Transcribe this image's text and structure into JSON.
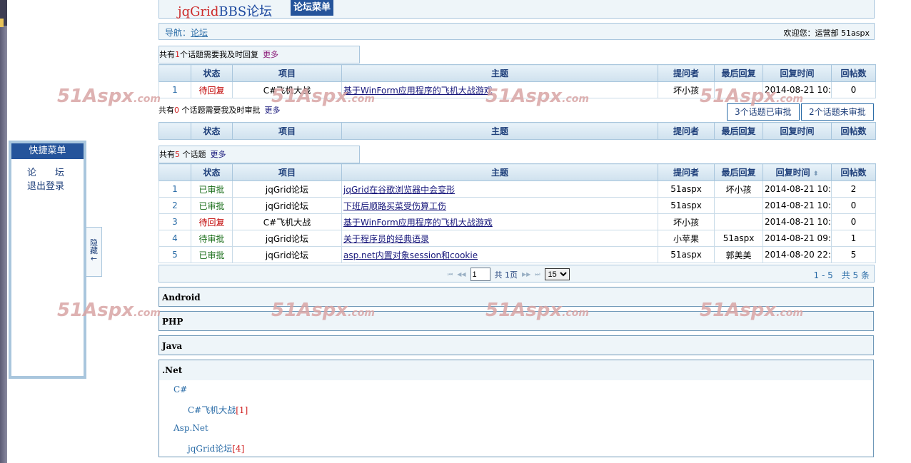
{
  "header": {
    "logo_part1": "jqGrid",
    "logo_part2": "BBS论坛",
    "menu_label": "论坛菜单"
  },
  "nav": {
    "label": "导航：",
    "link": "论坛",
    "welcome": "欢迎您：运营部 51aspx"
  },
  "quick_menu": {
    "title": "快捷菜单",
    "items": [
      "论　　坛",
      "退出登录"
    ],
    "hide_tab": "隐藏←"
  },
  "pending_reply": {
    "prefix": "共有",
    "count": "1",
    "suffix": "个话题需要我及时回复",
    "more": "更多"
  },
  "pending_review": {
    "prefix": "共有",
    "count": "0",
    "suffix": " 个话题需要我及时审批",
    "more": "更多",
    "approved_btn": "3个话题已审批",
    "unapproved_btn": "2个话题未审批"
  },
  "all_topics": {
    "prefix": "共有",
    "count": "5",
    "suffix": " 个话题",
    "more": "更多"
  },
  "columns": [
    "",
    "状态",
    "项目",
    "主题",
    "提问者",
    "最后回复",
    "回复时间",
    "回帖数"
  ],
  "sort_indicator": "⬍",
  "reply_rows": [
    [
      "1",
      "待回复",
      "C#飞机大战",
      "基于WinForm应用程序的飞机大战游戏",
      "坏小孩",
      "",
      "2014-08-21 10:",
      "0"
    ]
  ],
  "topic_rows": [
    [
      "1",
      "已审批",
      "jqGrid论坛",
      "jqGrid在谷歌浏览器中会变形",
      "51aspx",
      "坏小孩",
      "2014-08-21 10:",
      "2"
    ],
    [
      "2",
      "已审批",
      "jqGrid论坛",
      "下班后顺路买菜受伤算工伤",
      "51aspx",
      "",
      "2014-08-21 10:",
      "0"
    ],
    [
      "3",
      "待回复",
      "C#飞机大战",
      "基于WinForm应用程序的飞机大战游戏",
      "坏小孩",
      "",
      "2014-08-21 10:",
      "0"
    ],
    [
      "4",
      "待审批",
      "jqGrid论坛",
      "关于程序员的经典语录",
      "小苹果",
      "51aspx",
      "2014-08-21 09:",
      "1"
    ],
    [
      "5",
      "已审批",
      "jqGrid论坛",
      "asp.net内置对象session和cookie",
      "51aspx",
      "郭美美",
      "2014-08-20 22:",
      "5"
    ]
  ],
  "pager": {
    "first": "⏮",
    "prev": "◀◀",
    "page": "1",
    "total_pages": "共 1页",
    "next": "▶▶",
    "last": "⏭",
    "page_size": "15",
    "range": "1 - 5　共 5 条"
  },
  "categories": [
    "Android",
    "PHP",
    "Java"
  ],
  "tree": {
    "title": ".Net",
    "nodes": [
      {
        "label": "C#"
      },
      {
        "label": "C#飞机大战",
        "count": "[1]"
      },
      {
        "label": "Asp.Net"
      },
      {
        "label": "jqGrid论坛",
        "count": "[4]"
      }
    ]
  },
  "watermark": {
    "main": "51Aspx",
    "suffix": ".com"
  },
  "colors": {
    "accent": "#25549b",
    "border": "#a9c6dd",
    "header_bg": "#eef5f9",
    "status_red": "#c00000",
    "status_green": "#1a6e1a"
  }
}
